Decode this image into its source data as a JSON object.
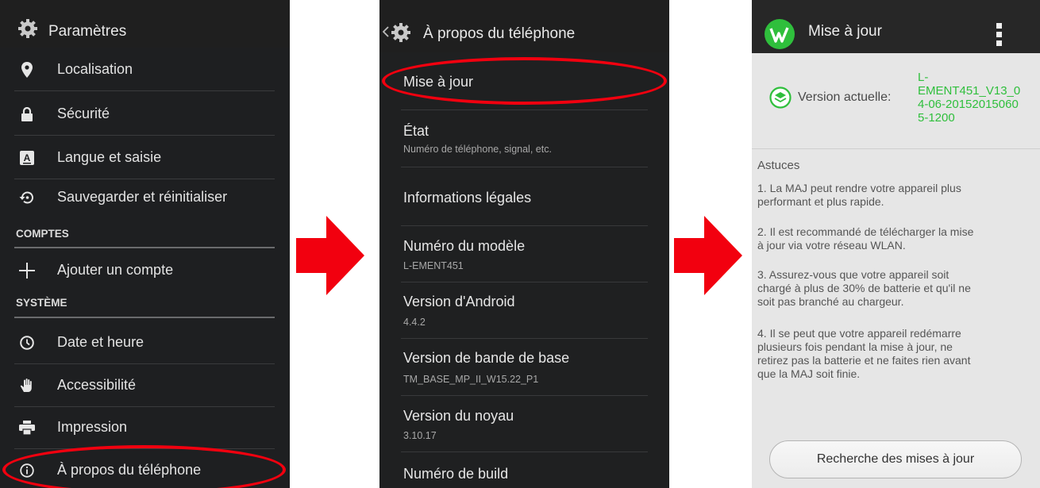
{
  "colors": {
    "accent_red": "#f2000f",
    "update_green": "#2fbf3c"
  },
  "settings": {
    "title": "Paramètres",
    "items_top": [
      {
        "icon": "location-pin-icon",
        "label": "Localisation"
      },
      {
        "icon": "lock-icon",
        "label": "Sécurité"
      },
      {
        "icon": "keyboard-a-icon",
        "label": "Langue et saisie"
      },
      {
        "icon": "backup-restore-icon",
        "label": "Sauvegarder et réinitialiser"
      }
    ],
    "section_accounts": "COMPTES",
    "add_account": {
      "icon": "plus-icon",
      "label": "Ajouter un compte"
    },
    "section_system": "SYSTÈME",
    "items_system": [
      {
        "icon": "clock-icon",
        "label": "Date et heure"
      },
      {
        "icon": "hand-icon",
        "label": "Accessibilité"
      },
      {
        "icon": "printer-icon",
        "label": "Impression"
      },
      {
        "icon": "info-icon",
        "label": "À propos du téléphone"
      }
    ]
  },
  "about": {
    "title": "À propos du téléphone",
    "items": [
      {
        "title": "Mise à jour",
        "subtitle": ""
      },
      {
        "title": "État",
        "subtitle": "Numéro de téléphone, signal, etc."
      },
      {
        "title": "Informations légales",
        "subtitle": ""
      },
      {
        "title": "Numéro du modèle",
        "subtitle": "L-EMENT451"
      },
      {
        "title": "Version d'Android",
        "subtitle": "4.4.2"
      },
      {
        "title": "Version de bande de base",
        "subtitle": "TM_BASE_MP_II_W15.22_P1"
      },
      {
        "title": "Version du noyau",
        "subtitle": "3.10.17"
      },
      {
        "title": "Numéro de build",
        "subtitle": ""
      }
    ]
  },
  "update": {
    "title": "Mise à jour",
    "version_label": "Version actuelle:",
    "version_lines": [
      "L-",
      "EMENT451_V13_0",
      "4-06-20152015060",
      "5-1200"
    ],
    "tips_heading": "Astuces",
    "tips": [
      [
        "1. La MAJ peut rendre votre appareil plus",
        "performant et plus rapide."
      ],
      [
        "2. Il est recommandé de télécharger la mise",
        "à jour via votre réseau WLAN."
      ],
      [
        "3. Assurez-vous que votre appareil soit",
        "chargé à plus de 30% de batterie et qu'il ne",
        "soit pas branché au chargeur."
      ],
      [
        "4. Il se peut que votre appareil redémarre",
        "plusieurs fois pendant la mise à jour, ne",
        "retirez pas la batterie et ne faites rien avant",
        "que la MAJ soit finie."
      ]
    ],
    "button_label": "Recherche des mises à jour"
  }
}
